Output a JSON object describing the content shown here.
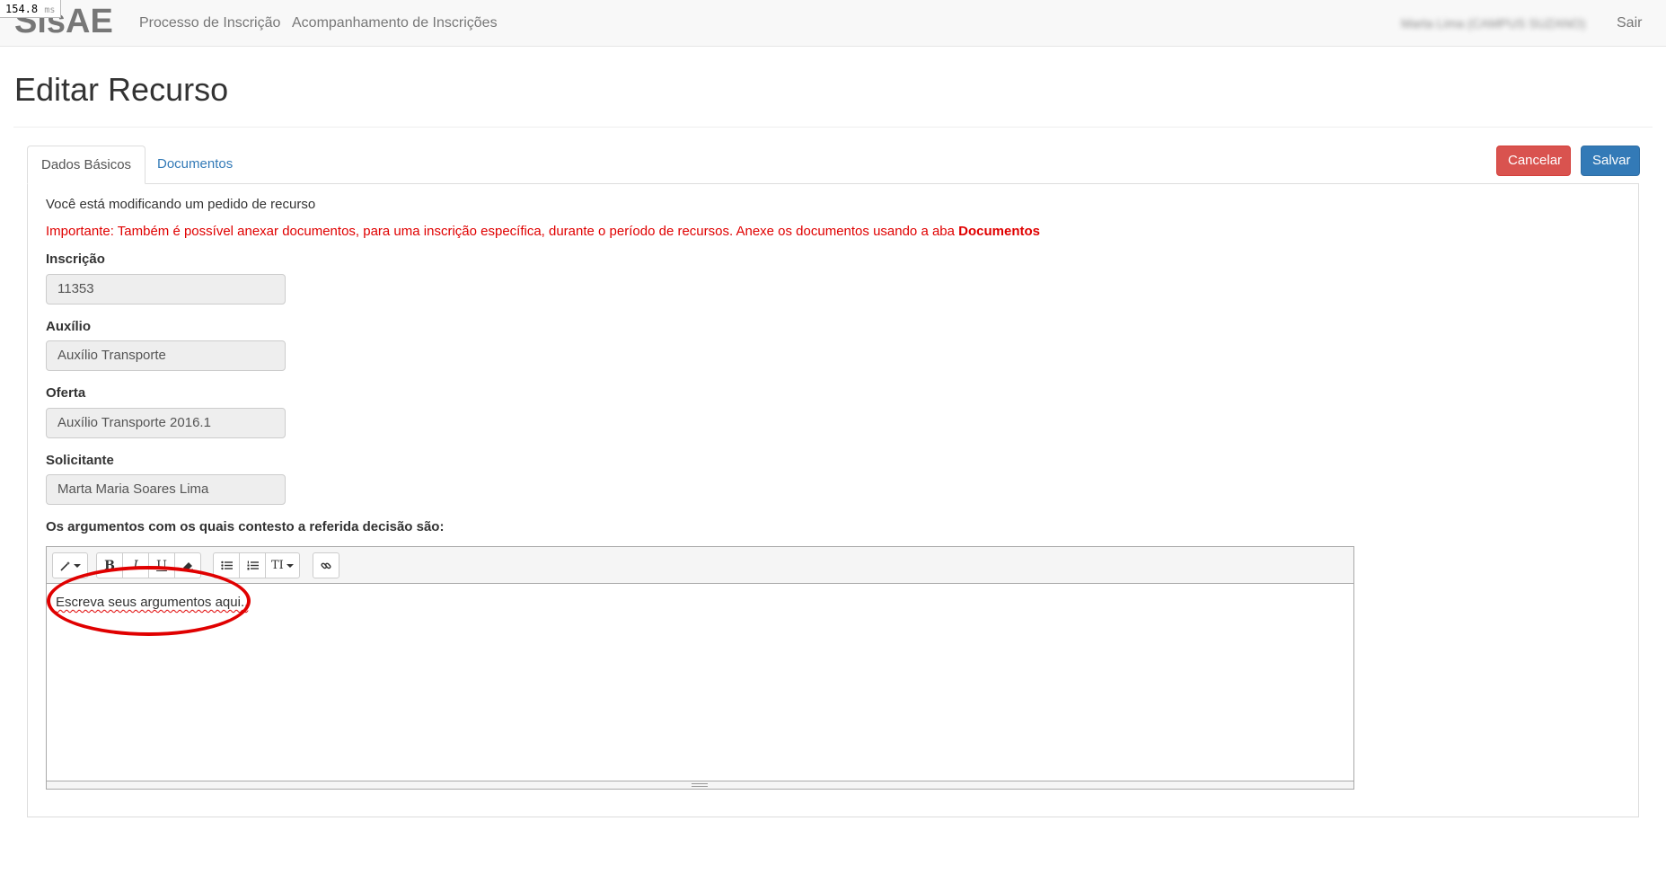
{
  "timing": {
    "value": "154.8",
    "unit": "ms"
  },
  "navbar": {
    "brand": "SisAE",
    "links": [
      "Processo de Inscrição",
      "Acompanhamento de Inscrições"
    ],
    "user": "Marta Lima (CAMPUS SUZANO)",
    "logout": "Sair"
  },
  "page": {
    "title": "Editar Recurso",
    "tabs": [
      "Dados Básicos",
      "Documentos"
    ],
    "cancel_label": "Cancelar",
    "save_label": "Salvar"
  },
  "form": {
    "info": "Você está modificando um pedido de recurso",
    "warning_prefix": "Importante: Também é possível anexar documentos, para uma inscrição específica, durante o período de recursos. Anexe os documentos usando a aba ",
    "warning_link": "Documentos",
    "fields": [
      {
        "label": "Inscrição",
        "value": "11353"
      },
      {
        "label": "Auxílio",
        "value": "Auxílio Transporte"
      },
      {
        "label": "Oferta",
        "value": "Auxílio Transporte 2016.1"
      },
      {
        "label": "Solicitante",
        "value": "Marta Maria Soares Lima"
      }
    ],
    "arguments_label": "Os argumentos com os quais contesto a referida decisão são:",
    "editor_text": "Escreva seus argumentos aqui..",
    "toolbar": {
      "style": "magic-icon",
      "bold": "B",
      "italic": "I",
      "underline": "U",
      "eraser": "eraser-icon",
      "ul": "unordered-list-icon",
      "ol": "ordered-list-icon",
      "font_size": "TI",
      "link": "link-icon"
    }
  },
  "colors": {
    "danger": "#d9534f",
    "primary": "#337ab7",
    "warning_text": "#e00000",
    "annotation": "#e00000"
  }
}
